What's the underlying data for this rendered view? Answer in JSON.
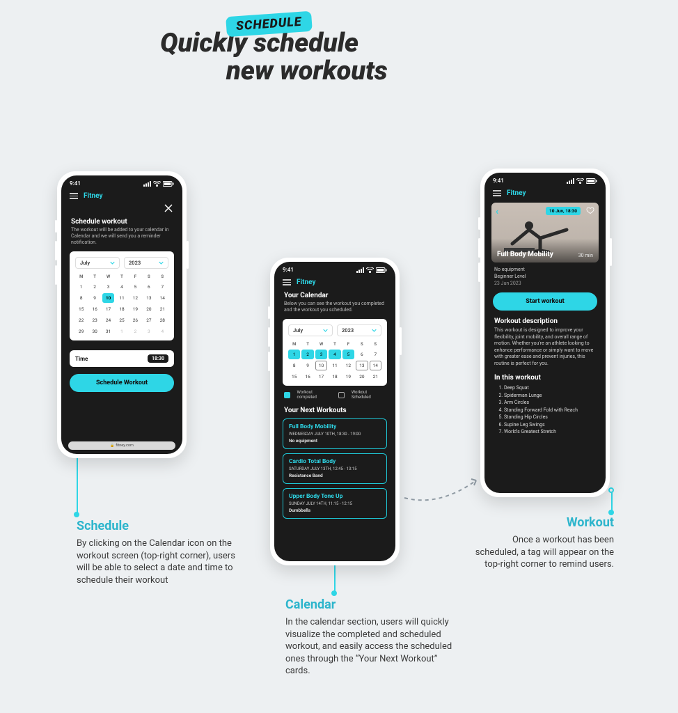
{
  "hero": {
    "tag": "SCHEDULE",
    "line1": "Quickly schedule",
    "line2": "new workouts"
  },
  "captions": {
    "schedule": {
      "title": "Schedule",
      "body": "By clicking on the Calendar icon on the workout screen (top-right corner), users will be able to select a date and time to schedule their workout"
    },
    "calendar": {
      "title": "Calendar",
      "body": "In the calendar section, users will quickly visualize the completed and scheduled workout, and easily access the scheduled ones through the “Your Next Workout” cards."
    },
    "workout": {
      "title": "Workout",
      "body": "Once a workout has been scheduled, a tag will appear on the top-right corner to remind users."
    }
  },
  "status_time": "9:41",
  "brand": "Fitney",
  "phone1": {
    "title": "Schedule workout",
    "subtitle": "The workout will be added to your calendar in Calendar and we will send you a reminder notification.",
    "month": "July",
    "year": "2023",
    "dow": [
      "M",
      "T",
      "W",
      "T",
      "F",
      "S",
      "S"
    ],
    "rows": [
      [
        "1",
        "2",
        "3",
        "4",
        "5",
        "6",
        "7"
      ],
      [
        "8",
        "9",
        "10",
        "11",
        "12",
        "13",
        "14"
      ],
      [
        "15",
        "16",
        "17",
        "18",
        "19",
        "20",
        "21"
      ],
      [
        "22",
        "23",
        "24",
        "25",
        "26",
        "27",
        "28"
      ],
      [
        "29",
        "30",
        "31",
        "1",
        "2",
        "3",
        "4"
      ]
    ],
    "selected": "10",
    "time_label": "Time",
    "time_value": "18:30",
    "cta": "Schedule Workout",
    "url": "fitney.com"
  },
  "phone2": {
    "title": "Your Calendar",
    "subtitle": "Below you can see the workout you completed and the workout you scheduled.",
    "month": "July",
    "year": "2023",
    "dow": [
      "M",
      "T",
      "W",
      "T",
      "F",
      "S",
      "S"
    ],
    "rows": [
      [
        "1",
        "2",
        "3",
        "4",
        "5",
        "6",
        "7"
      ],
      [
        "8",
        "9",
        "10",
        "11",
        "12",
        "13",
        "14"
      ],
      [
        "15",
        "16",
        "17",
        "18",
        "19",
        "20",
        "21"
      ]
    ],
    "completed": [
      "1",
      "2",
      "3",
      "4",
      "5"
    ],
    "scheduled": [
      "10",
      "13",
      "14"
    ],
    "legend1": "Workout completed",
    "legend2": "Workout Scheduled",
    "next_title": "Your Next Workouts",
    "cards": [
      {
        "title": "Full Body Mobility",
        "meta": "WEDNESDAY JULY 10TH, 18:30 - 19:00",
        "equip": "No equipment"
      },
      {
        "title": "Cardio Total Body",
        "meta": "SATURDAY JULY 13TH, 12:45 - 13:15",
        "equip": "Resistance Band"
      },
      {
        "title": "Upper Body Tone Up",
        "meta": "SUNDAY JULY 14TH, 11:15 - 12:15",
        "equip": "Dumbbells"
      }
    ]
  },
  "phone3": {
    "tag": "10 Jun, 18:30",
    "title": "Full Body Mobility",
    "duration": "30 min",
    "meta_equip": "No equipment",
    "meta_level": "Beginner Level",
    "meta_date": "23 Jun 2023",
    "cta": "Start workout",
    "desc_title": "Workout description",
    "desc": "This workout is designed to improve your flexibility, joint mobility, and overall range of motion. Whether you're an athlete looking to enhance performance or simply want to move with greater ease and prevent injuries, this routine is perfect for you.",
    "itw_title": "In this workout",
    "exercises": [
      "Deep Squat",
      "Spiderman Lunge",
      "Arm Circles",
      "Standing Forward Fold with Reach",
      "Standing Hip Circles",
      "Supine Leg Swings",
      "World's Greatest Stretch"
    ]
  }
}
